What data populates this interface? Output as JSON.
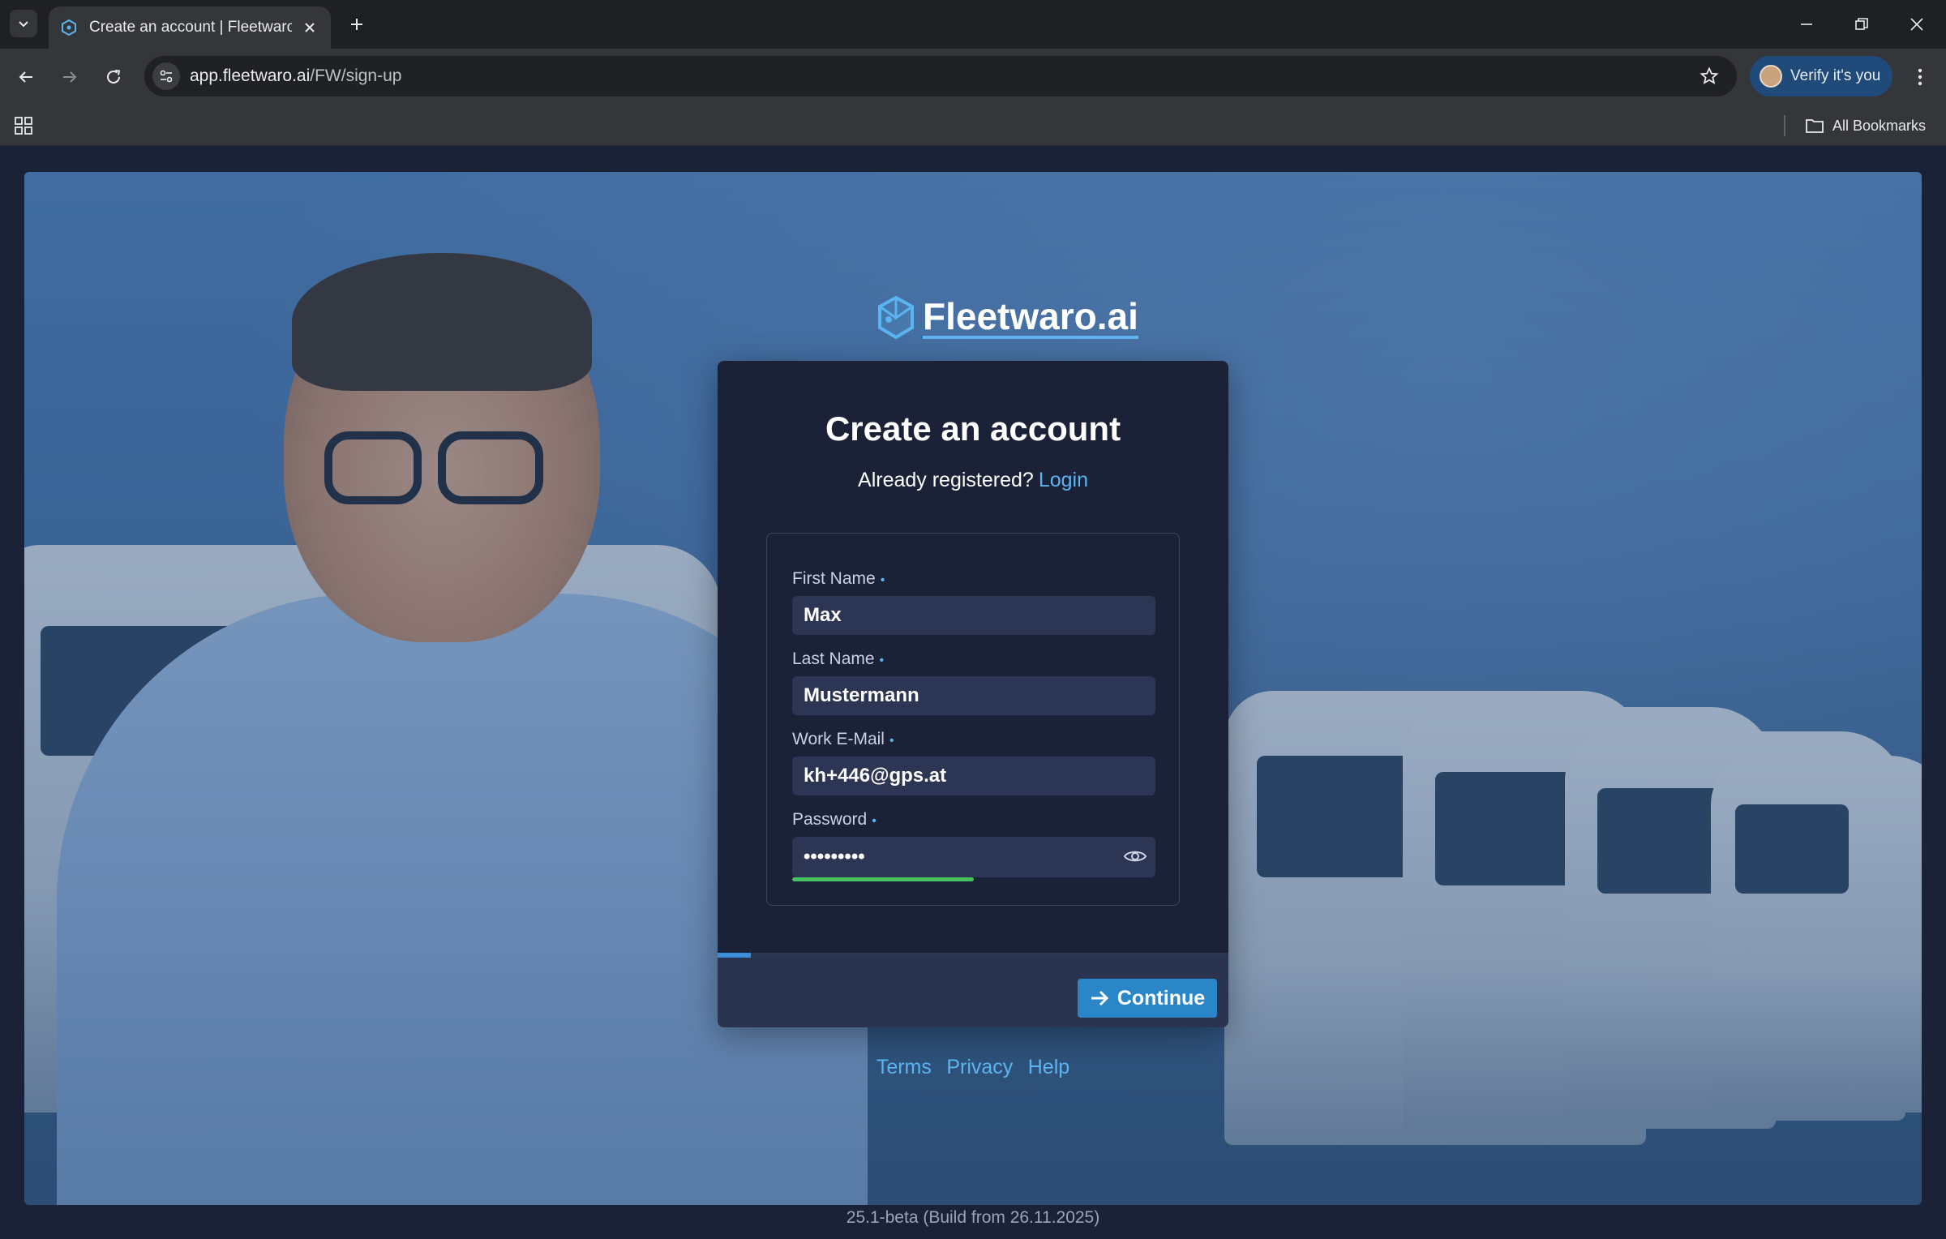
{
  "browser": {
    "tab_title": "Create an account | Fleetwaro.ai",
    "url_host": "app.fleetwaro.ai",
    "url_path": "/FW/sign-up",
    "profile_label": "Verify it's you",
    "bookmarks_label": "All Bookmarks"
  },
  "brand": {
    "name": "Fleetwaro.ai",
    "accent": "#5ab4f0"
  },
  "card": {
    "title": "Create an account",
    "already_registered": "Already registered?",
    "login_link": "Login",
    "required_marker": "•",
    "fields": {
      "first_name": {
        "label": "First Name",
        "value": "Max"
      },
      "last_name": {
        "label": "Last Name",
        "value": "Mustermann"
      },
      "email": {
        "label": "Work E-Mail",
        "value": "kh+446@gps.at"
      },
      "password": {
        "label": "Password",
        "value": "•••••••••",
        "strength_fraction": 0.5
      }
    },
    "step_progress_fraction": 0.065,
    "continue_label": "Continue"
  },
  "footer_links": {
    "terms": "Terms",
    "privacy": "Privacy",
    "help": "Help"
  },
  "version": "25.1-beta (Build from 26.11.2025)"
}
